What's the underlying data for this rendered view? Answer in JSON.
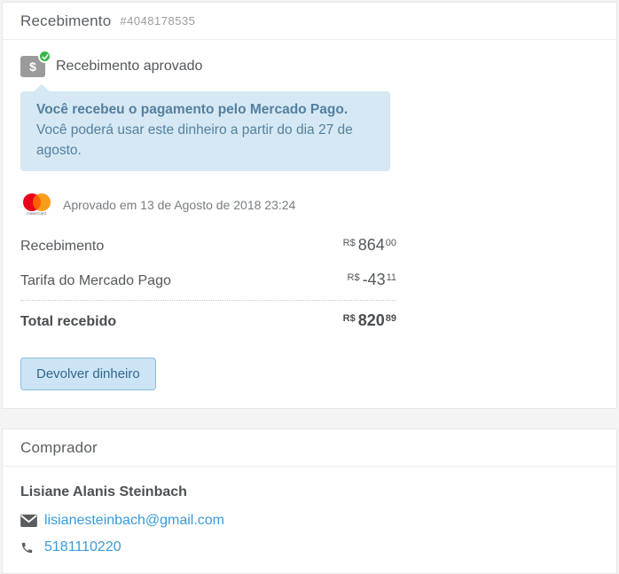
{
  "colors": {
    "page_bg": "#f4f4f4",
    "card_border": "#e7e7e7",
    "success_green": "#39b54a",
    "tooltip_bg": "#d5e8f4",
    "tooltip_text": "#54809f",
    "link_blue": "#3a9ad9",
    "button_bg": "#cce4f5",
    "button_border": "#8cbcdf",
    "button_text": "#33688e",
    "mastercard_red": "#eb001b",
    "mastercard_orange": "#f79e1b",
    "mastercard_overlap": "#ff5f00"
  },
  "receipt": {
    "title": "Recebimento",
    "id": "#4048178535",
    "status": {
      "icon_glyph": "$",
      "label": "Recebimento aprovado"
    },
    "tooltip": {
      "line1": "Você recebeu o pagamento pelo Mercado Pago.",
      "line2": "Você poderá usar este dinheiro a partir do dia 27 de agosto."
    },
    "payment_method": {
      "brand": "mastercard",
      "approved_text": "Aprovado em 13 de Agosto de 2018 23:24"
    },
    "line_items": [
      {
        "label": "Recebimento",
        "currency": "R$",
        "amount": "864",
        "cents": "00"
      },
      {
        "label": "Tarifa do Mercado Pago",
        "currency": "R$",
        "amount": "-43",
        "cents": "11"
      }
    ],
    "total": {
      "label": "Total recebido",
      "currency": "R$",
      "amount": "820",
      "cents": "89"
    },
    "refund_button_label": "Devolver dinheiro"
  },
  "buyer": {
    "title": "Comprador",
    "name": "Lisiane Alanis Steinbach",
    "email": "lisianesteinbach@gmail.com",
    "phone": "5181110220"
  }
}
